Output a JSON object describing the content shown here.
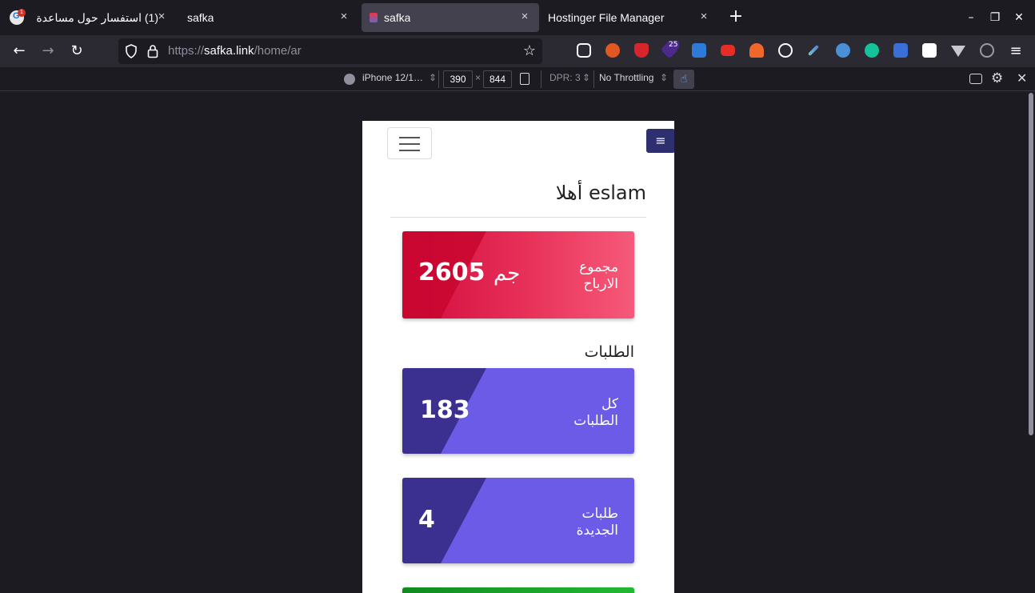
{
  "browser": {
    "tabs": [
      {
        "label": "(1) استفسار حول مساعدة",
        "active": false
      },
      {
        "label": "safka",
        "active": false
      },
      {
        "label": "safka",
        "active": true
      },
      {
        "label": "Hostinger File Manager",
        "active": false
      }
    ],
    "url_prefix": "https://",
    "url_host": "safka.link",
    "url_path": "/home/ar",
    "extension_badge": "25"
  },
  "rdm": {
    "device": "iPhone 12/1…",
    "width": "390",
    "times": "×",
    "height": "844",
    "dpr": "DPR: 3",
    "throttling": "No Throttling"
  },
  "page": {
    "greeting": "أهلا eslam",
    "profit_card": {
      "value": "2605",
      "currency": "جم",
      "label_line1": "مجموع",
      "label_line2": "الارباح"
    },
    "orders_title": "الطلبات",
    "all_orders_card": {
      "value": "183",
      "label_line1": "كل",
      "label_line2": "الطلبات"
    },
    "new_orders_card": {
      "value": "4",
      "label_line1": "طلبات",
      "label_line2": "الجديدة"
    }
  },
  "colors": {
    "profit_card": "#e8325a",
    "orders_card": "#6b5be6",
    "orders_card_dark": "#3b2f8f",
    "next_card": "#1a9e2a",
    "menu_button": "#2d2f6e"
  }
}
